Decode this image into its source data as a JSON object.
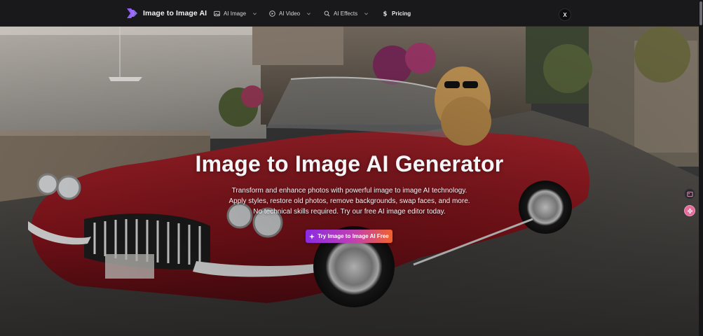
{
  "nav": {
    "brand": "Image to Image AI",
    "items": [
      {
        "label": "AI Image",
        "icon": "image-icon",
        "has_dropdown": true
      },
      {
        "label": "AI Video",
        "icon": "play-circle-icon",
        "has_dropdown": true
      },
      {
        "label": "AI Effects",
        "icon": "sparkle-search-icon",
        "has_dropdown": true
      },
      {
        "label": "Pricing",
        "icon": "dollar-icon",
        "has_dropdown": false
      }
    ],
    "close_label": "X"
  },
  "hero": {
    "title": "Image to Image AI Generator",
    "subtitle_lines": [
      "Transform and enhance photos with powerful image to image AI technology.",
      "Apply styles, restore old photos, remove backgrounds, swap faces, and more.",
      "No technical skills required. Try our free AI image editor today."
    ],
    "cta_label": "Try Image to Image AI Free",
    "background": "Red vintage convertible with a dog in sunglasses on a cobblestone street"
  },
  "colors": {
    "nav_bg": "#19191b",
    "accent_start": "#8a2be2",
    "accent_end": "#f0622c"
  }
}
